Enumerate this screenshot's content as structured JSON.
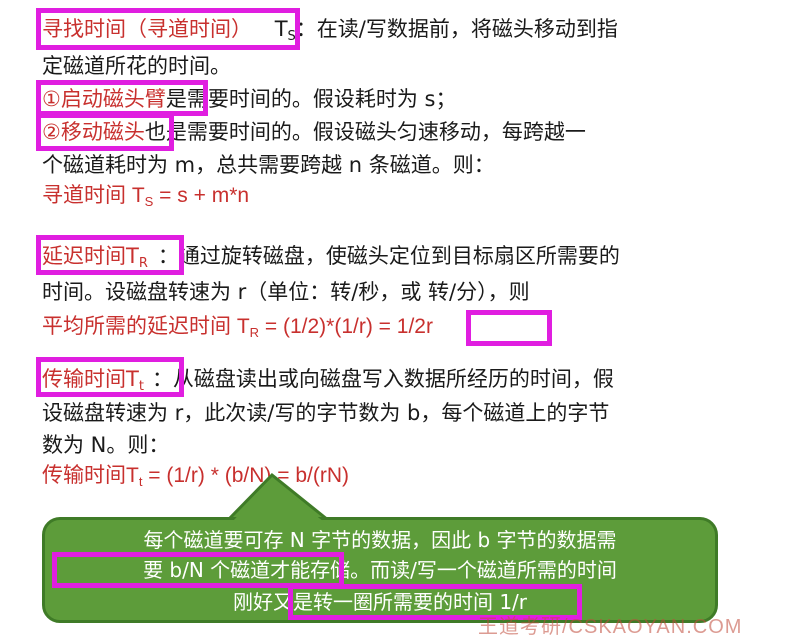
{
  "seek": {
    "term": "寻找时间（寻道时间）",
    "symbol": "T",
    "symbol_sub": "S",
    "desc_1": "：在读/写数据前，将磁头移动到指",
    "desc_2": "定磁道所花的时间。",
    "item1_label": "①启动磁头臂",
    "item1_rest": "是需要时间的。假设耗时为 s；",
    "item2_label": "②移动磁头",
    "item2_rest": "也是需要时间的。假设磁头匀速移动，每跨越一",
    "item2_line2": "个磁道耗时为 m，总共需要跨越 n 条磁道。则：",
    "formula_prefix": "寻道时间 T",
    "formula_sub": "S",
    "formula_rest": " = s + m*n"
  },
  "latency": {
    "term": "延迟时间T",
    "term_sub": "R",
    "desc_1": "：通过旋转磁盘，使磁头定位到目标扇区所需要的",
    "desc_2": "时间。设磁盘转速为 r（单位：转/秒，或 转/分），则",
    "formula_prefix": "平均所需的延迟时间 T",
    "formula_sub": "R",
    "formula_mid": " = (1/2)*(1/r) = ",
    "formula_result": "1/2r"
  },
  "transfer": {
    "term": "传输时间T",
    "term_sub": "t",
    "desc_1": "：从磁盘读出或向磁盘写入数据所经历的时间，假",
    "desc_2": "设磁盘转速为 r，此次读/写的字节数为 b，每个磁道上的字节",
    "desc_3": "数为 N。则：",
    "formula_prefix": "传输时间T",
    "formula_sub": "t",
    "formula_rest": " = (1/r) * (b/N) = b/(rN)"
  },
  "callout": {
    "line1": "每个磁道要可存 N 字节的数据，因此 b 字节的数据需",
    "line2_a": "要 b/N 个磁道才能存储",
    "line2_b": "。而读/写一个磁道所需的时间",
    "line3_a": "刚好又是",
    "line3_b": "转一圈所需要的时间 1/r"
  },
  "watermark": "王道考研/CSKAOYAN.COM",
  "colors": {
    "highlight_box": "#e01ee0",
    "formula_text": "#c8302e",
    "callout_bg": "#5d9c3a"
  }
}
